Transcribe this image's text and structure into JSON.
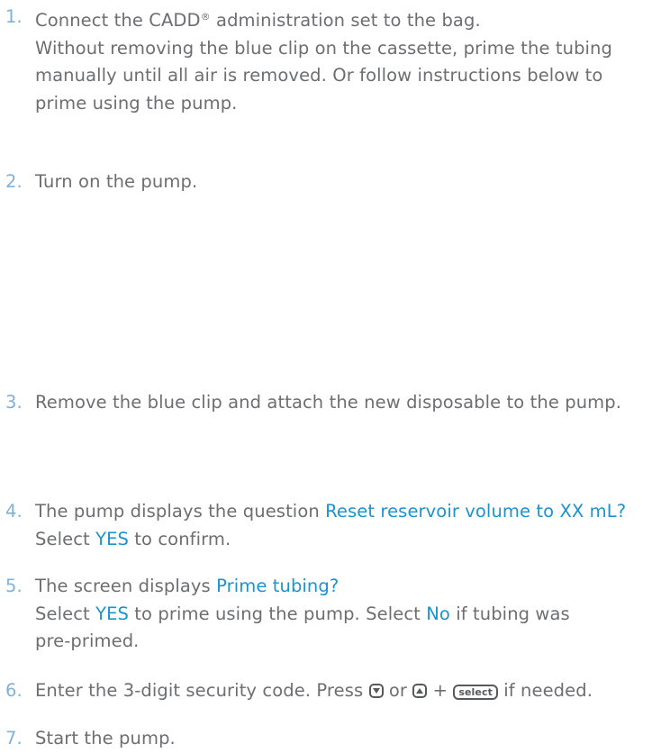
{
  "steps": [
    {
      "num": "1.",
      "line1_a": "Connect the CADD",
      "line1_reg": "®",
      "line1_b": " administration set to the bag.",
      "line2": "Without removing the blue clip on the cassette, prime the tubing",
      "line3": "manually until all air is removed. Or follow instructions below to",
      "line4": "prime using the pump."
    },
    {
      "num": "2.",
      "line1": "Turn on the pump."
    },
    {
      "num": "3.",
      "line1": "Remove the blue clip and attach the new disposable to the pump."
    },
    {
      "num": "4.",
      "line1_a": "The pump displays the question ",
      "line1_hl": "Reset reservoir volume to XX mL?",
      "line2_a": "Select ",
      "line2_hl": "YES",
      "line2_b": " to confirm."
    },
    {
      "num": "5.",
      "line1_a": "The screen displays ",
      "line1_hl": "Prime tubing?",
      "line2_a": "Select ",
      "line2_hl": "YES",
      "line2_b": " to prime using the pump. Select ",
      "line2_hl2": "No",
      "line2_c": " if tubing was",
      "line3": "pre-primed."
    },
    {
      "num": "6.",
      "line1_a": "Enter the 3-digit security code. Press ",
      "key_down": "down-arrow-key-icon",
      "line1_or": " or ",
      "key_up": "up-arrow-key-icon",
      "line1_plus": " + ",
      "select_key": "select",
      "line1_b": " if needed."
    },
    {
      "num": "7.",
      "line1": "Start the pump."
    }
  ]
}
